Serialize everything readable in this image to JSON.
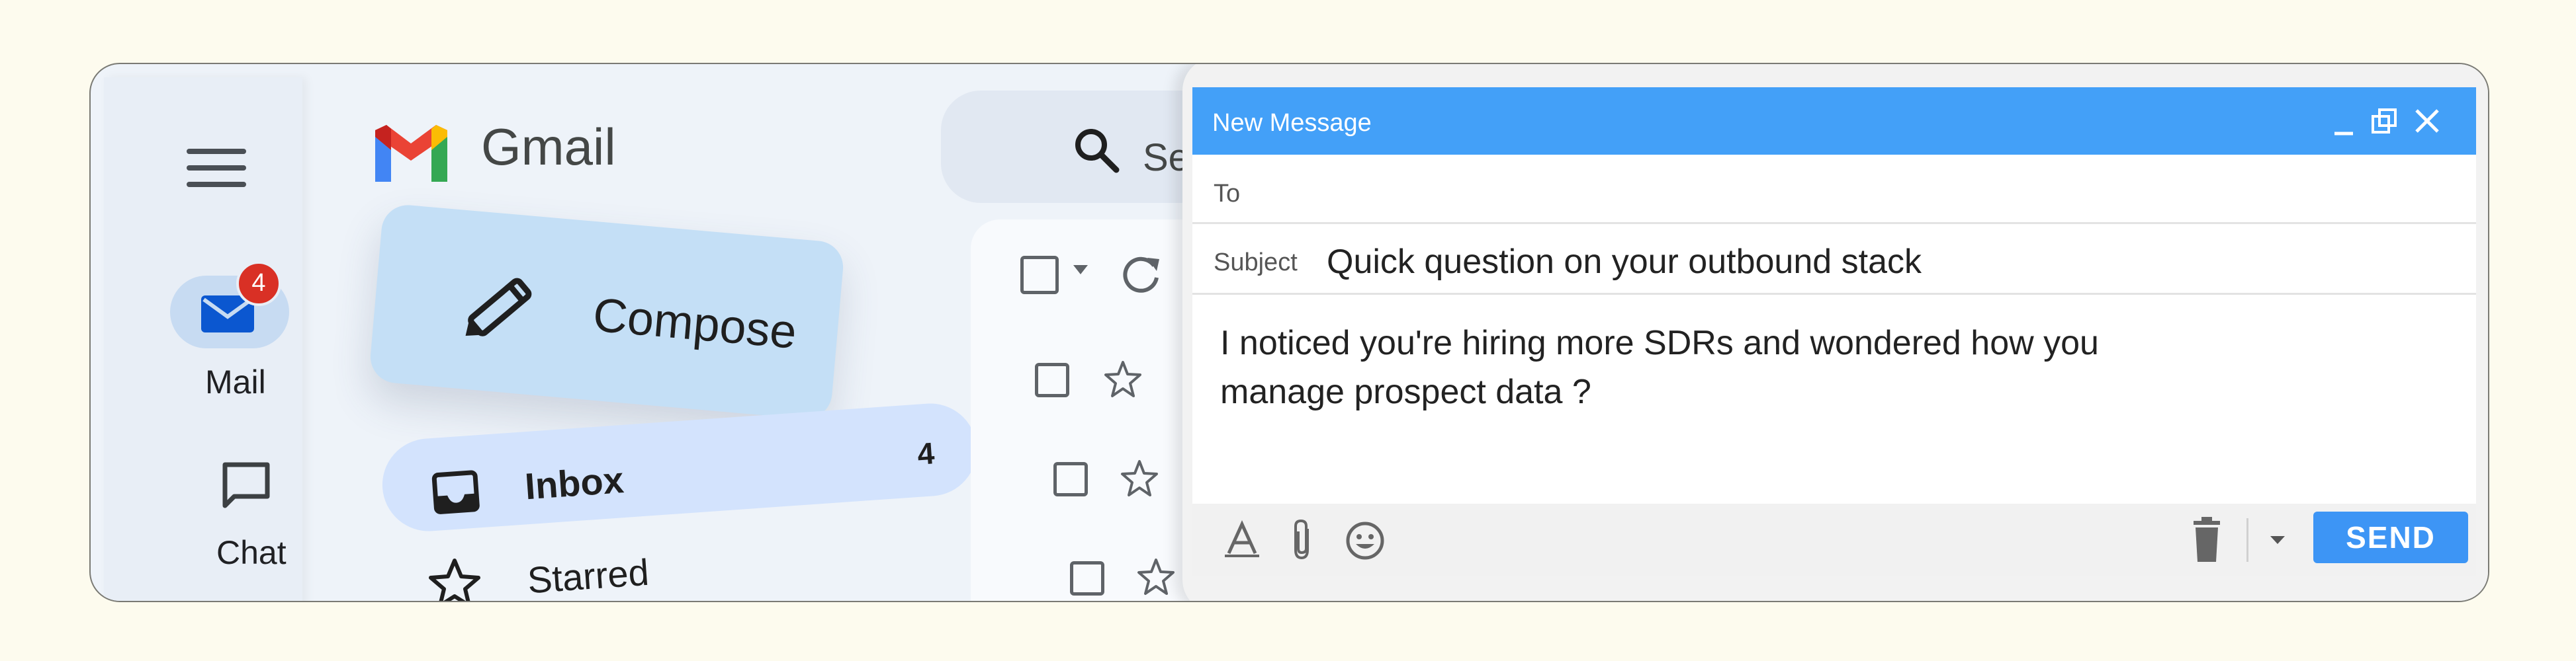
{
  "rail": {
    "mail_label": "Mail",
    "mail_badge": "4",
    "chat_label": "Chat"
  },
  "header": {
    "app_name": "Gmail",
    "search_placeholder": "Searc"
  },
  "nav": {
    "compose_label": "Compose",
    "inbox_label": "Inbox",
    "inbox_count": "4",
    "starred_label": "Starred"
  },
  "compose_window": {
    "title": "New Message",
    "to_label": "To",
    "to_value": "",
    "subject_label": "Subject",
    "subject_value": "Quick question on your outbound stack",
    "body_lines": [
      "I noticed you're hiring more SDRs and wondered how you",
      "manage prospect data ?"
    ],
    "send_label": "SEND"
  },
  "colors": {
    "page_background": "#fdfbee",
    "compose_header": "#43a0f8",
    "send_button": "#3d95f5",
    "badge": "#d93025",
    "compose_fab": "#c4dff6",
    "inbox_highlight": "#d3e3fd"
  },
  "icons": [
    "menu-icon",
    "mail-icon",
    "chat-icon",
    "gmail-logo-icon",
    "pencil-icon",
    "inbox-icon",
    "star-icon",
    "search-icon",
    "checkbox-icon",
    "refresh-icon",
    "minimize-icon",
    "popout-icon",
    "close-icon",
    "text-format-icon",
    "attachment-icon",
    "emoji-icon",
    "trash-icon",
    "chevron-down-icon"
  ]
}
